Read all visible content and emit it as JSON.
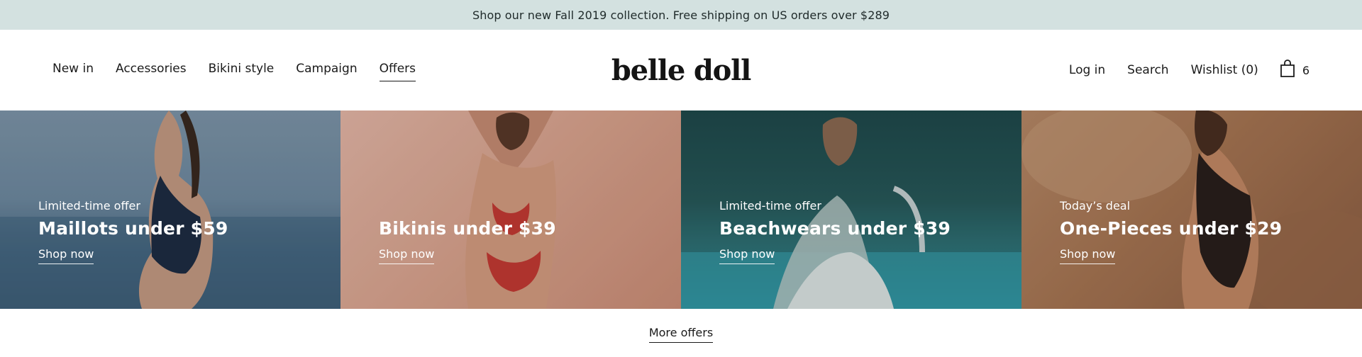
{
  "announcement": {
    "text": "Shop our new Fall 2019 collection. Free shipping on US orders over $289"
  },
  "header": {
    "nav_left": [
      {
        "label": "New in"
      },
      {
        "label": "Accessories"
      },
      {
        "label": "Bikini style"
      },
      {
        "label": "Campaign"
      },
      {
        "label": "Offers",
        "active": true
      }
    ],
    "logo": "belle doll",
    "nav_right": {
      "login": "Log in",
      "search": "Search",
      "wishlist": "Wishlist (0)",
      "cart_count": "6"
    }
  },
  "tiles": [
    {
      "eyebrow": "Limited-time offer",
      "title": "Maillots under $59",
      "cta": "Shop now"
    },
    {
      "eyebrow": "",
      "title": "Bikinis under $39",
      "cta": "Shop now"
    },
    {
      "eyebrow": "Limited-time offer",
      "title": "Beachwears under $39",
      "cta": "Shop now"
    },
    {
      "eyebrow": "Today’s deal",
      "title": "One-Pieces under $29",
      "cta": "Shop now"
    }
  ],
  "more": {
    "label": "More offers"
  },
  "icons": {
    "cart": "shopping-bag-icon"
  },
  "colors": {
    "announcement_bg": "#d3e1e0",
    "text": "#1a1a1a"
  }
}
